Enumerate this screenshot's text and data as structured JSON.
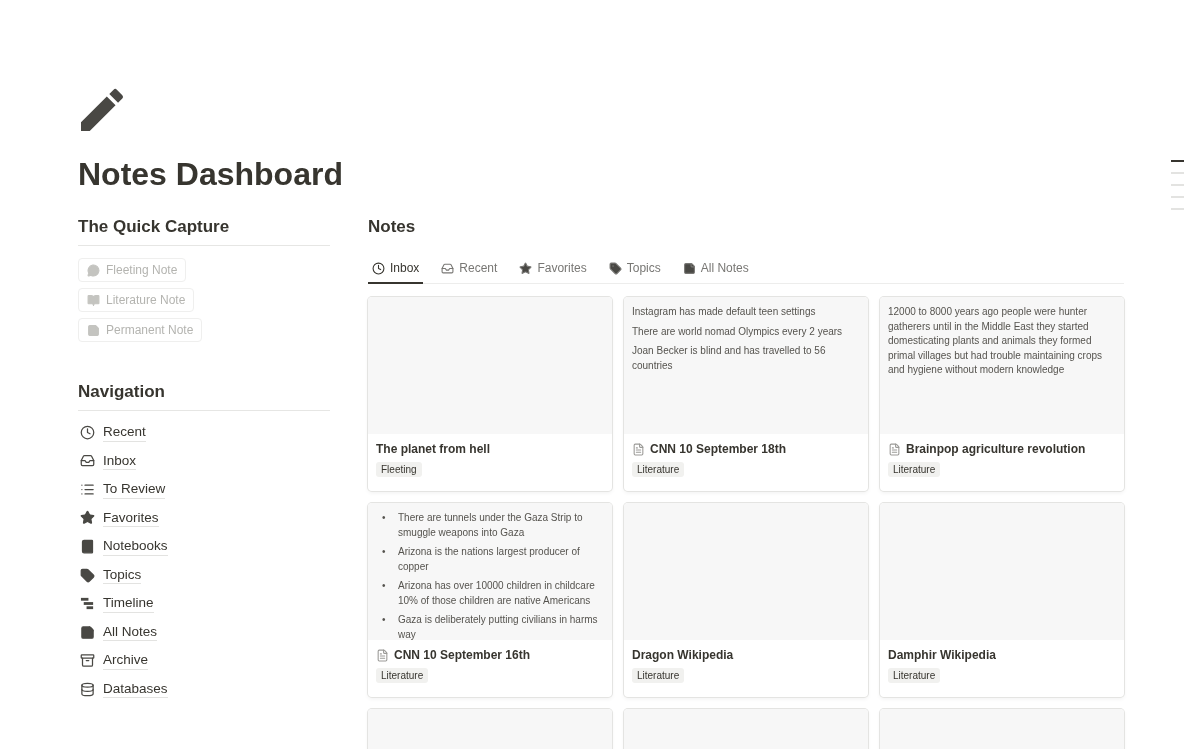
{
  "page": {
    "title": "Notes Dashboard"
  },
  "quick_capture": {
    "heading": "The Quick Capture",
    "buttons": [
      {
        "label": "Fleeting Note",
        "disabled": true
      },
      {
        "label": "Literature Note",
        "disabled": true
      },
      {
        "label": "Permanent Note",
        "disabled": true
      }
    ]
  },
  "navigation": {
    "heading": "Navigation",
    "items": [
      {
        "label": "Recent"
      },
      {
        "label": "Inbox"
      },
      {
        "label": "To Review"
      },
      {
        "label": "Favorites"
      },
      {
        "label": "Notebooks"
      },
      {
        "label": "Topics"
      },
      {
        "label": "Timeline"
      },
      {
        "label": "All Notes"
      },
      {
        "label": "Archive"
      },
      {
        "label": "Databases"
      }
    ]
  },
  "notes": {
    "heading": "Notes",
    "tabs": [
      {
        "label": "Inbox",
        "selected": true
      },
      {
        "label": "Recent",
        "selected": false
      },
      {
        "label": "Favorites",
        "selected": false
      },
      {
        "label": "Topics",
        "selected": false
      },
      {
        "label": "All Notes",
        "selected": false
      }
    ],
    "cards": [
      {
        "preview": {
          "kind": "empty"
        },
        "title": "The planet from hell",
        "doc_icon": false,
        "tag": "Fleeting"
      },
      {
        "preview": {
          "kind": "lines",
          "lines": [
            "Instagram has made default teen settings",
            "There are world nomad Olympics every 2 years",
            "Joan Becker is blind and has travelled to 56 countries"
          ]
        },
        "title": "CNN 10 September 18th",
        "doc_icon": true,
        "tag": "Literature"
      },
      {
        "preview": {
          "kind": "lines",
          "lines": [
            "12000 to 8000 years ago people were hunter gatherers until in the Middle East they started domesticating plants and animals they formed primal villages but had trouble maintaining crops and hygiene without modern knowledge"
          ]
        },
        "title": "Brainpop agriculture revolution",
        "doc_icon": true,
        "tag": "Literature"
      },
      {
        "preview": {
          "kind": "bullets",
          "bullet": "•",
          "lines": [
            "There are tunnels under the Gaza Strip to smuggle weapons into Gaza",
            "Arizona is the nations largest producer of copper",
            "Arizona has over 10000 children in childcare 10% of those children are native Americans",
            "Gaza is deliberately putting civilians in harms way"
          ]
        },
        "title": "CNN 10 September 16th",
        "doc_icon": true,
        "tag": "Literature"
      },
      {
        "preview": {
          "kind": "empty"
        },
        "title": "Dragon Wikipedia",
        "doc_icon": false,
        "tag": "Literature"
      },
      {
        "preview": {
          "kind": "empty"
        },
        "title": "Damphir Wikipedia",
        "doc_icon": false,
        "tag": "Literature"
      },
      {
        "preview": {
          "kind": "empty"
        }
      },
      {
        "preview": {
          "kind": "empty"
        }
      },
      {
        "preview": {
          "kind": "empty"
        }
      }
    ]
  }
}
